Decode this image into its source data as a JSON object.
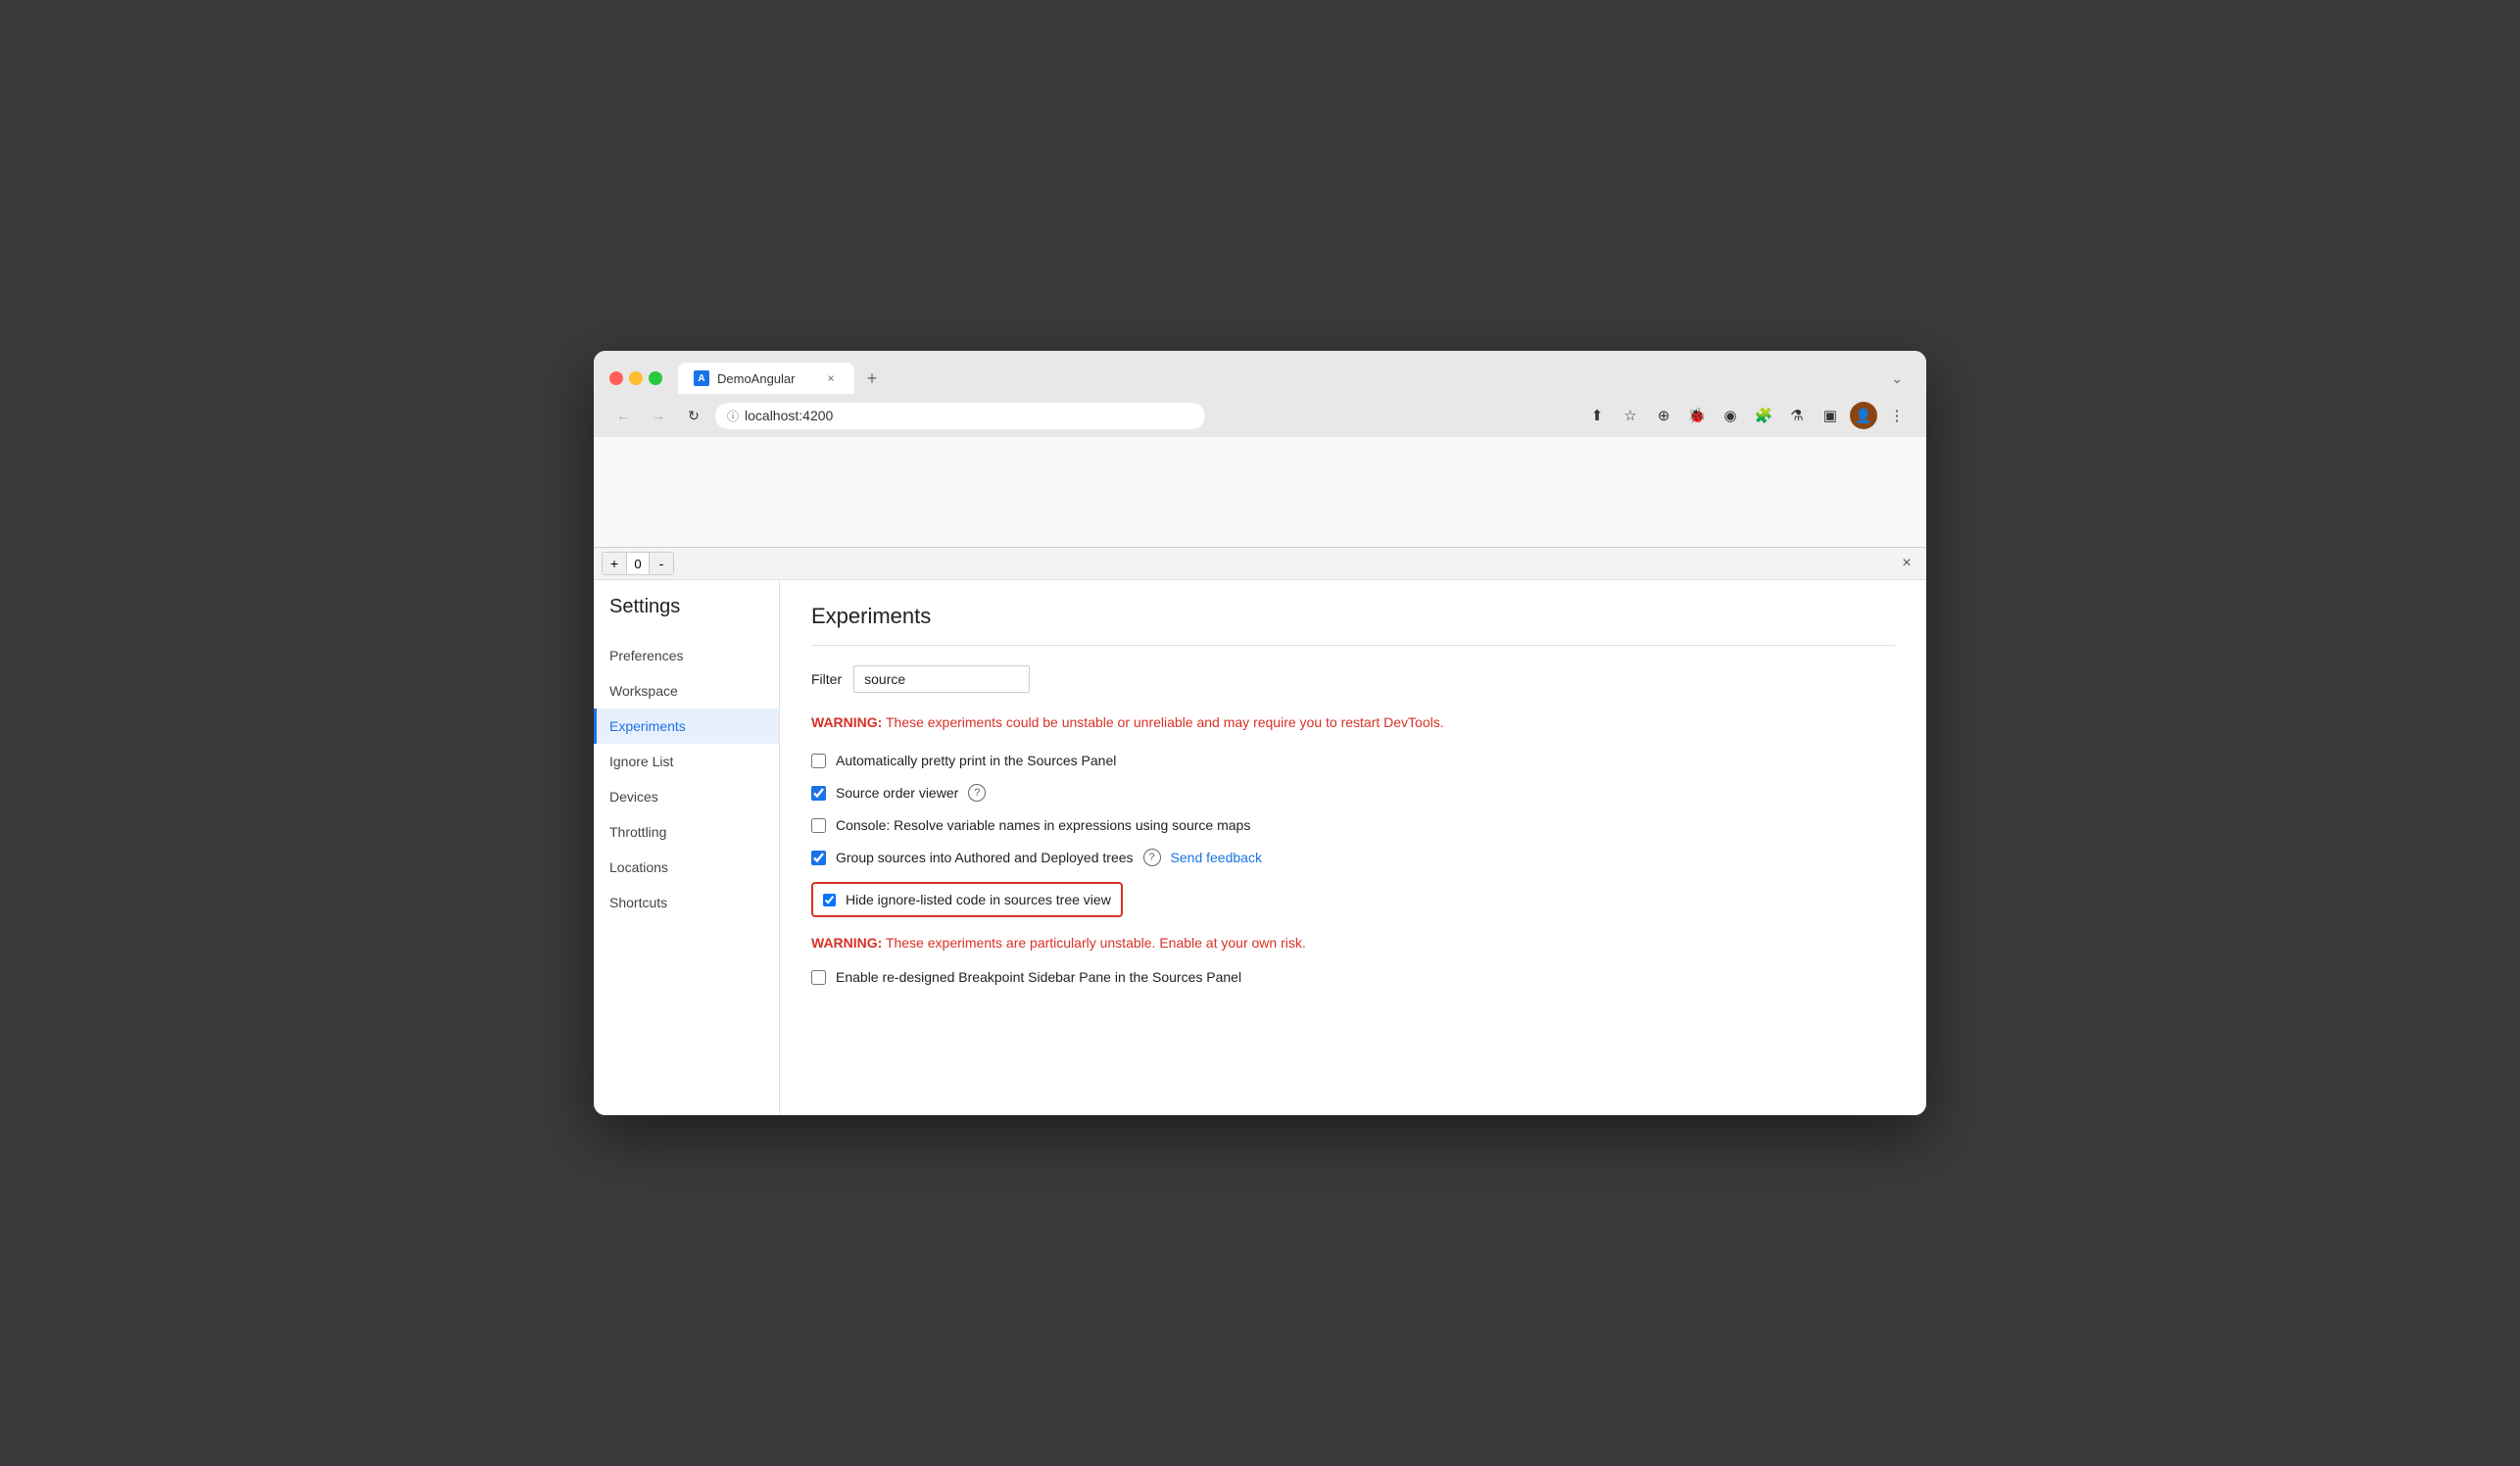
{
  "browser": {
    "tab_title": "DemoAngular",
    "tab_close": "×",
    "new_tab": "+",
    "chevron_down": "⌄",
    "address": "localhost:4200",
    "back_btn": "←",
    "forward_btn": "→",
    "reload_btn": "↻"
  },
  "devtools": {
    "close_btn": "×",
    "counter": {
      "plus": "+",
      "value": "0",
      "minus": "-"
    }
  },
  "settings": {
    "title": "Settings",
    "sidebar_items": [
      {
        "label": "Preferences",
        "active": false
      },
      {
        "label": "Workspace",
        "active": false
      },
      {
        "label": "Experiments",
        "active": true
      },
      {
        "label": "Ignore List",
        "active": false
      },
      {
        "label": "Devices",
        "active": false
      },
      {
        "label": "Throttling",
        "active": false
      },
      {
        "label": "Locations",
        "active": false
      },
      {
        "label": "Shortcuts",
        "active": false
      }
    ],
    "content": {
      "title": "Experiments",
      "filter_label": "Filter",
      "filter_value": "source",
      "filter_placeholder": "",
      "warning1": {
        "label": "WARNING:",
        "text": " These experiments could be unstable or unreliable and may require you to restart DevTools."
      },
      "options": [
        {
          "id": "opt1",
          "checked": false,
          "label": "Automatically pretty print in the Sources Panel",
          "has_help": false,
          "has_feedback": false,
          "highlighted": false
        },
        {
          "id": "opt2",
          "checked": true,
          "label": "Source order viewer",
          "has_help": true,
          "has_feedback": false,
          "highlighted": false
        },
        {
          "id": "opt3",
          "checked": false,
          "label": "Console: Resolve variable names in expressions using source maps",
          "has_help": false,
          "has_feedback": false,
          "highlighted": false
        },
        {
          "id": "opt4",
          "checked": true,
          "label": "Group sources into Authored and Deployed trees",
          "has_help": true,
          "has_feedback": true,
          "highlighted": false
        },
        {
          "id": "opt5",
          "checked": true,
          "label": "Hide ignore-listed code in sources tree view",
          "has_help": false,
          "has_feedback": false,
          "highlighted": true
        }
      ],
      "warning2": {
        "label": "WARNING:",
        "text": " These experiments are particularly unstable. Enable at your own risk."
      },
      "options2": [
        {
          "id": "opt6",
          "checked": false,
          "label": "Enable re-designed Breakpoint Sidebar Pane in the Sources Panel",
          "has_help": false,
          "has_feedback": false
        }
      ],
      "send_feedback_label": "Send feedback",
      "help_icon_label": "?"
    }
  }
}
